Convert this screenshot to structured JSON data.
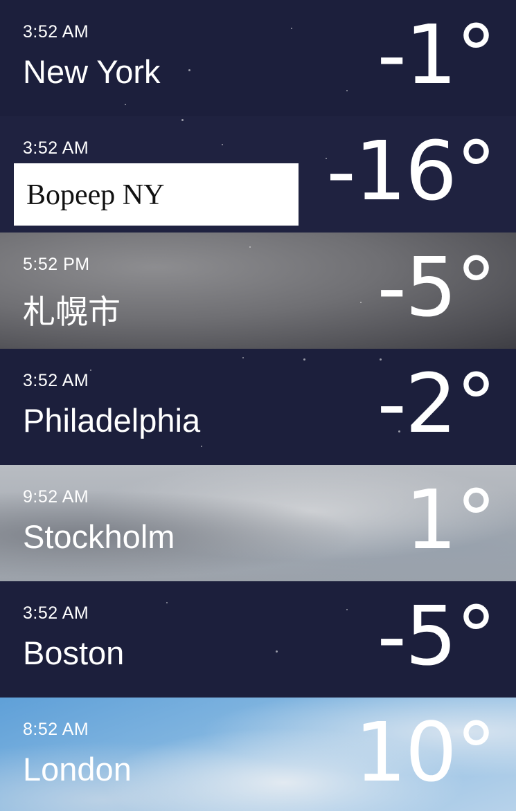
{
  "locations": [
    {
      "time": "3:52 AM",
      "city": "New York",
      "temp": "-1°",
      "style": "night"
    },
    {
      "time": "3:52 AM",
      "city": "",
      "temp": "-16°",
      "style": "night",
      "overlay_text": "Bopeep NY"
    },
    {
      "time": "5:52 PM",
      "city": "札幌市",
      "temp": "-5°",
      "style": "cloudy-night"
    },
    {
      "time": "3:52 AM",
      "city": "Philadelphia",
      "temp": "-2°",
      "style": "night"
    },
    {
      "time": "9:52 AM",
      "city": "Stockholm",
      "temp": "1°",
      "style": "cloudy-day"
    },
    {
      "time": "3:52 AM",
      "city": "Boston",
      "temp": "-5°",
      "style": "night"
    },
    {
      "time": "8:52 AM",
      "city": "London",
      "temp": "10°",
      "style": "sunny-clouds"
    }
  ]
}
